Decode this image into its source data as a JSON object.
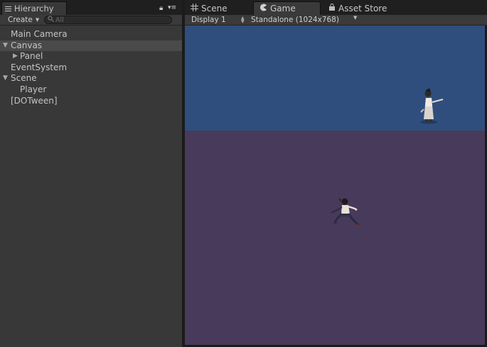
{
  "hierarchy": {
    "tab_title": "Hierarchy",
    "create_label": "Create",
    "search_placeholder": "All",
    "items": [
      {
        "label": "Main Camera"
      },
      {
        "label": "Canvas"
      },
      {
        "label": "Panel"
      },
      {
        "label": "EventSystem"
      },
      {
        "label": "Scene"
      },
      {
        "label": "Player"
      },
      {
        "label": "[DOTween]"
      }
    ]
  },
  "editor_tabs": {
    "scene": "Scene",
    "game": "Game",
    "asset_store": "Asset Store"
  },
  "game_toolbar": {
    "display": "Display 1",
    "resolution": "Standalone (1024x768)"
  },
  "colors": {
    "sky": "#2f4e7d",
    "ground": "#483a5a",
    "panel_bg": "#383838"
  }
}
